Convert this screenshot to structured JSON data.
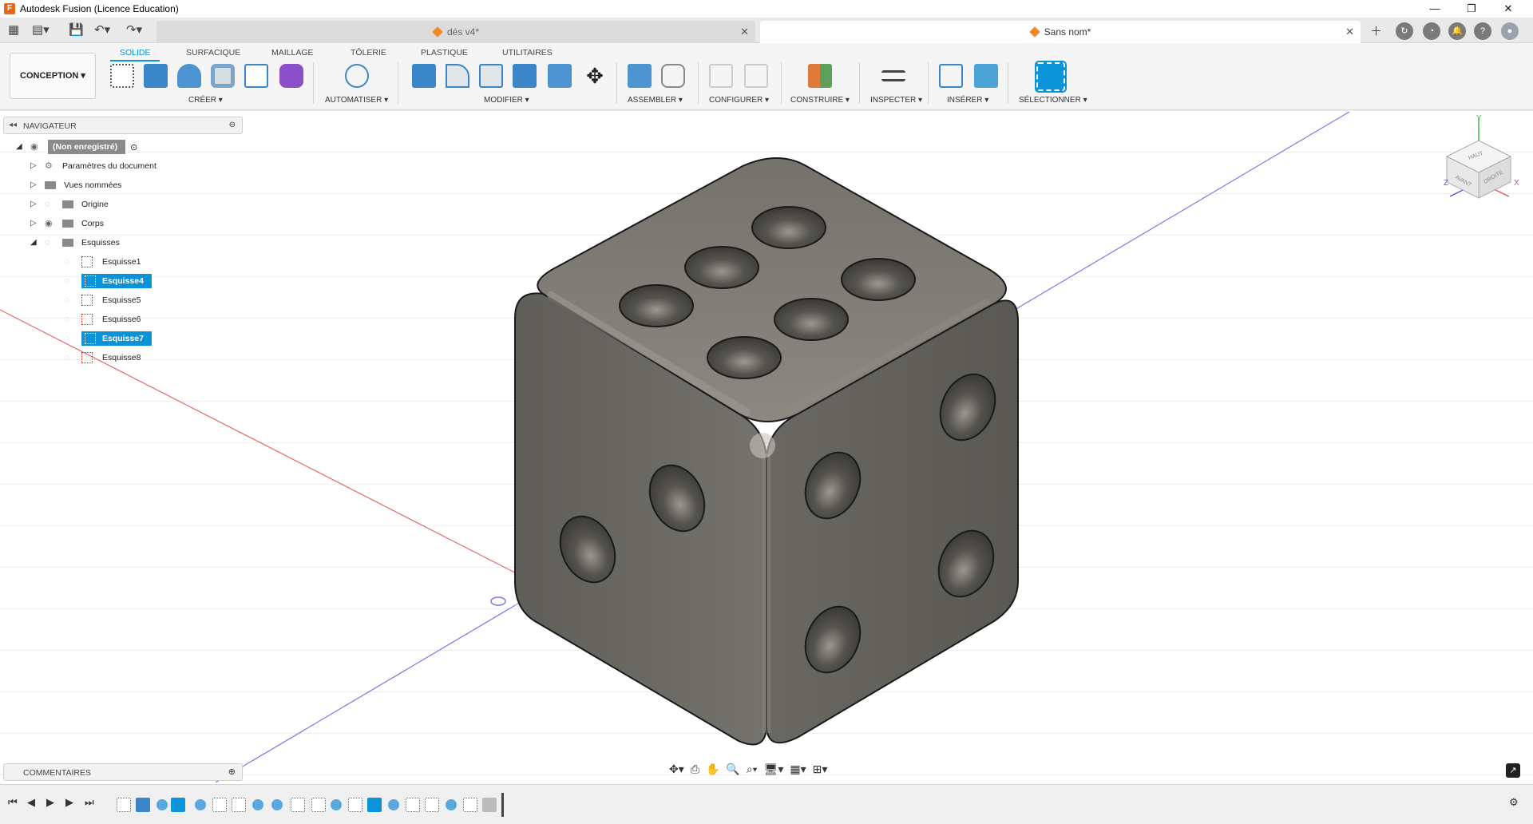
{
  "window": {
    "title": "Autodesk Fusion (Licence Education)",
    "controls": [
      "—",
      "❐",
      "✕"
    ]
  },
  "tabs": [
    {
      "label": "dés v4*",
      "active": false
    },
    {
      "label": "Sans nom*",
      "active": true
    }
  ],
  "ribbon": {
    "workspace": "CONCEPTION ▾",
    "tabs": [
      "SOLIDE",
      "SURFACIQUE",
      "MAILLAGE",
      "TÔLERIE",
      "PLASTIQUE",
      "UTILITAIRES"
    ],
    "active_tab": "SOLIDE",
    "groups": [
      "CRÉER ▾",
      "AUTOMATISER ▾",
      "MODIFIER ▾",
      "ASSEMBLER ▾",
      "CONFIGURER ▾",
      "CONSTRUIRE ▾",
      "INSPECTER ▾",
      "INSÉRER ▾",
      "SÉLECTIONNER ▾"
    ]
  },
  "navigator": {
    "title": "NAVIGATEUR",
    "root": "(Non enregistré)",
    "items": [
      "Paramètres du document",
      "Vues nommées",
      "Origine",
      "Corps",
      "Esquisses"
    ],
    "sketches": [
      {
        "label": "Esquisse1",
        "selected": false
      },
      {
        "label": "Esquisse4",
        "selected": true
      },
      {
        "label": "Esquisse5",
        "selected": false
      },
      {
        "label": "Esquisse6",
        "selected": false
      },
      {
        "label": "Esquisse7",
        "selected": true
      },
      {
        "label": "Esquisse8",
        "selected": false
      }
    ]
  },
  "comments": {
    "title": "COMMENTAIRES"
  },
  "viewcube": {
    "top": "HAUT",
    "front": "AVANT",
    "right": "DROITE",
    "axis_x": "X",
    "axis_y": "Y",
    "axis_z": "Z"
  },
  "colors": {
    "accent": "#0696d7",
    "selection": "#0a93d8",
    "die_body": "#6e6c66",
    "grid": "#dcdcdc"
  }
}
